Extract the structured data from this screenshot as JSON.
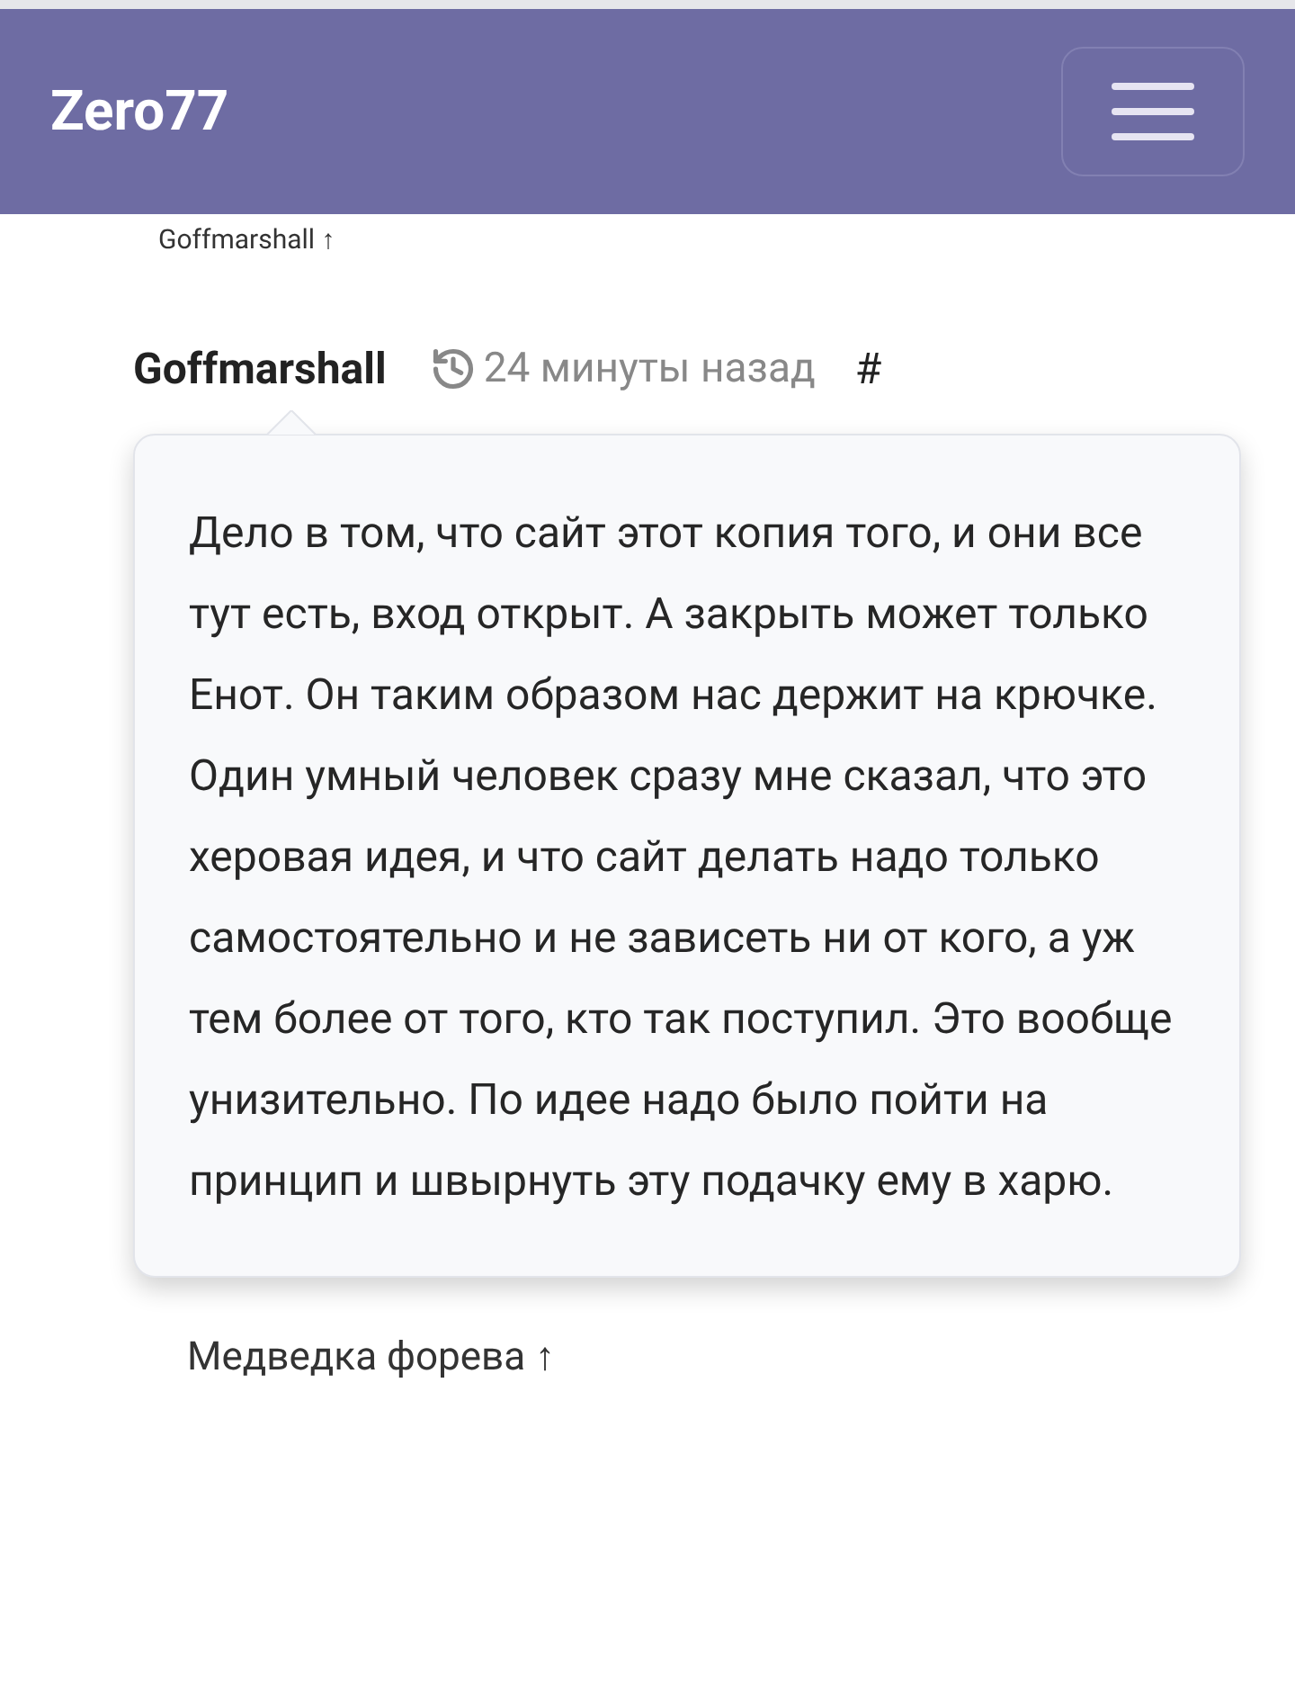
{
  "navbar": {
    "brand": "Zero77"
  },
  "parent_reply": {
    "author": "Goffmarshall",
    "arrow": "↑"
  },
  "comment": {
    "author": "Goffmarshall",
    "time": "24 минуты назад",
    "anchor": "#",
    "text": "Дело в том, что сайт этот копия того, и они все тут есть, вход открыт. А закрыть может только Енот. Он таким образом нас держит на крючке. Один умный человек сразу мне сказал, что это херовая идея, и что сайт делать надо только самостоятельно и не зависеть ни от кого, а уж тем более от того, кто так поступил. Это вообще унизительно. По идее надо было пойти на принцип и швырнуть эту подачку ему в харю."
  },
  "reply_link": {
    "author": "Медведка форева",
    "arrow": "↑"
  }
}
